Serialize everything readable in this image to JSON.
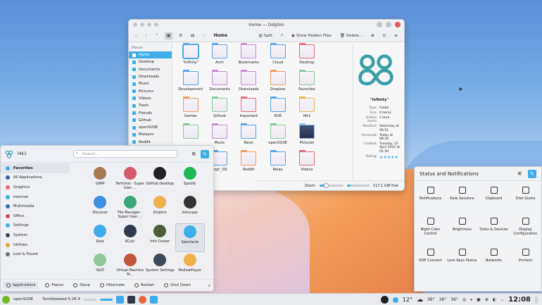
{
  "dolphin": {
    "title": "Home — Dolphin",
    "breadcrumb": "Home",
    "toolbar": {
      "split": "Split",
      "show_hidden": "Show Hidden Files",
      "delete": "Delete..."
    },
    "places_header": "Places",
    "places": [
      "Home",
      "Desktop",
      "Documents",
      "Downloads",
      "Music",
      "Pictures",
      "Videos",
      "Trash",
      "Friends",
      "Github",
      "openSUSE",
      "Manjaro",
      "Reddit"
    ],
    "files": [
      {
        "name": "\"Infinity\"",
        "color": "b"
      },
      {
        "name": "Arch",
        "color": "b"
      },
      {
        "name": "Bookmarks",
        "color": "p"
      },
      {
        "name": "Cloud",
        "color": "b"
      },
      {
        "name": "Desktop",
        "color": "r"
      },
      {
        "name": "",
        "color": ""
      },
      {
        "name": "Development",
        "color": "b"
      },
      {
        "name": "Documents",
        "color": "p"
      },
      {
        "name": "Downloads",
        "color": "p"
      },
      {
        "name": "Dropbox",
        "color": "o"
      },
      {
        "name": "Favorites",
        "color": "g"
      },
      {
        "name": "",
        "color": ""
      },
      {
        "name": "Games",
        "color": "o"
      },
      {
        "name": "Github",
        "color": "g"
      },
      {
        "name": "Important",
        "color": "r"
      },
      {
        "name": "KDE",
        "color": "b"
      },
      {
        "name": "l4k1",
        "color": "y"
      },
      {
        "name": "",
        "color": ""
      },
      {
        "name": "",
        "color": "g"
      },
      {
        "name": "Music",
        "color": "p"
      },
      {
        "name": "Neon",
        "color": "b"
      },
      {
        "name": "openSUSE",
        "color": "g"
      },
      {
        "name": "Pictures",
        "color": "dk"
      },
      {
        "name": "",
        "color": ""
      },
      {
        "name": "",
        "color": "g"
      },
      {
        "name": "Pop!_OS",
        "color": "b"
      },
      {
        "name": "Reddit",
        "color": "o"
      },
      {
        "name": "Relax",
        "color": "b"
      },
      {
        "name": "Videos",
        "color": "r"
      },
      {
        "name": "",
        "color": ""
      }
    ],
    "info": {
      "name": "\"Infinity\"",
      "rows": [
        {
          "k": "Type:",
          "v": "Folder"
        },
        {
          "k": "Size:",
          "v": "0 items"
        },
        {
          "k": "Hidden items:",
          "v": "1 item"
        },
        {
          "k": "Modified:",
          "v": "Yesterday at 00:51"
        },
        {
          "k": "Accessed:",
          "v": "Today at 08:34"
        },
        {
          "k": "Created:",
          "v": "Tuesday, 12 April 2022 at 01:30"
        },
        {
          "k": "Rating:",
          "v": "★★★★★"
        }
      ]
    },
    "status": {
      "zoom_label": "Zoom:",
      "free": "117.1 GiB free"
    }
  },
  "launcher": {
    "user": "l4k1",
    "search_placeholder": "Search...",
    "categories": [
      {
        "label": "Favorites",
        "color": "#3daee9"
      },
      {
        "label": "All Applications",
        "color": "#3d5ea8"
      },
      {
        "label": "Graphics",
        "color": "#e36a6a"
      },
      {
        "label": "Internet",
        "color": "#3daee9"
      },
      {
        "label": "Multimedia",
        "color": "#2f6fb3"
      },
      {
        "label": "Office",
        "color": "#d24b4b"
      },
      {
        "label": "Settings",
        "color": "#3daee9"
      },
      {
        "label": "System",
        "color": "#3d4a5a"
      },
      {
        "label": "Utilities",
        "color": "#e9a33b"
      },
      {
        "label": "Lost & Found",
        "color": "#6a6f78"
      }
    ],
    "apps": [
      {
        "label": "GIMP",
        "color": "#a77a52"
      },
      {
        "label": "Terminal - Super User ...",
        "color": "#d65a6a"
      },
      {
        "label": "GitHub Desktop",
        "color": "#222"
      },
      {
        "label": "Spotify",
        "color": "#1db954"
      },
      {
        "label": "Discover",
        "color": "#3d8fe0"
      },
      {
        "label": "File Manager - Super User ...",
        "color": "#3aa67a"
      },
      {
        "label": "Dolphin",
        "color": "#f0b04b"
      },
      {
        "label": "Inkscape",
        "color": "#333"
      },
      {
        "label": "Kate",
        "color": "#3daee9"
      },
      {
        "label": "KCalc",
        "color": "#2f3b4c"
      },
      {
        "label": "Info Center",
        "color": "#4d5e3a"
      },
      {
        "label": "Spectacle",
        "color": "#3daee9"
      },
      {
        "label": "YaST",
        "color": "#8fc79a"
      },
      {
        "label": "Virtual Machine M...",
        "color": "#c0573e"
      },
      {
        "label": "System Settings",
        "color": "#3c4a5a"
      },
      {
        "label": "MellowPlayer",
        "color": "#f0b04b"
      }
    ],
    "footer": [
      "Applications",
      "Places",
      "Sleep",
      "Hibernate",
      "Restart",
      "Shut Down"
    ]
  },
  "status_panel": {
    "title": "Status and Notifications",
    "items": [
      "Notifications",
      "Kate Sessions",
      "Clipboard",
      "Disk Quota",
      "Night Color Control",
      "Brightness",
      "Disks & Devices",
      "Display Configuration",
      "KDE Connect",
      "Lock Keys Status",
      "Networks",
      "Printers"
    ]
  },
  "taskbar": {
    "distro": "openSUSE",
    "version": "Tumbleweed 5.26.4",
    "weather": "12°",
    "temps": [
      "36°",
      "36°",
      "36°"
    ],
    "clock": "12:08"
  }
}
